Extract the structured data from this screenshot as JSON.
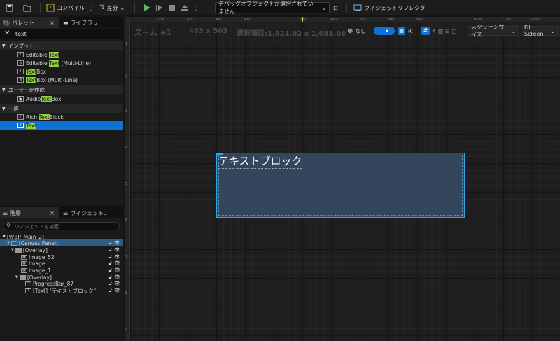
{
  "toolbar": {
    "compile_label": "コンパイル",
    "diff_label": "差分",
    "debug_dropdown": "デバッグオブジェクトが選択されていません",
    "reflector_label": "ウィジェットリフレクタ"
  },
  "palette": {
    "tab_palette": "パレット",
    "tab_library": "ライブラリ",
    "search_value": "text",
    "categories": [
      "インプット",
      "ユーザーが作成",
      "一般"
    ],
    "items": {
      "editable_text": {
        "pre": "Editable ",
        "hl": "Text",
        "post": ""
      },
      "editable_text_ml": {
        "pre": "Editable ",
        "hl": "Text",
        "post": " (Multi-Line)"
      },
      "text_box": {
        "pre": "",
        "hl": "Text",
        "post": "Box"
      },
      "text_box_ml": {
        "pre": "",
        "hl": "Text",
        "post": "Box (Multi-Line)"
      },
      "audio_text_box": {
        "pre": "Audio",
        "hl": "Text",
        "post": "Box"
      },
      "rich_text_block": {
        "pre": "Rich ",
        "hl": "Text",
        "post": "Block"
      },
      "text": {
        "pre": "",
        "hl": "Text",
        "post": ""
      }
    }
  },
  "hierarchy": {
    "tab_hierarchy": "階層",
    "tab_binds": "ウィジェット...",
    "search_placeholder": "ウィジェットを検索",
    "items": [
      "[WBP_Main_2]",
      "[Canvas Panel]",
      "[Overlay]",
      "Image_52",
      "Image",
      "Image_1",
      "[Overlay]",
      "ProgressBar_87",
      "[Text] \"テキストブロック\""
    ]
  },
  "canvas": {
    "zoom_label": "ズーム +1",
    "size_label": "483 x 503",
    "selection_label": "選択項目:1,921.92 x 1,081.08",
    "none_label": "なし",
    "r_label": "R",
    "grid_value": "4",
    "screen_size": "スクリーンサイズ",
    "fill_screen": "Fill Screen",
    "text_block": "テキストブロック",
    "ruler_top": [
      "100",
      "200",
      "300",
      "400",
      "500",
      "600",
      "700",
      "800",
      "900",
      "1000",
      "1100",
      "1200"
    ],
    "ruler_left": [
      "1",
      "2",
      "3",
      "4",
      "5",
      "6",
      "7",
      "8",
      "9"
    ]
  },
  "colors": {
    "accent": "#0e72d4",
    "highlight": "#8fd13f",
    "widget_fill": "#34465c",
    "widget_border": "#2aa7e6"
  }
}
